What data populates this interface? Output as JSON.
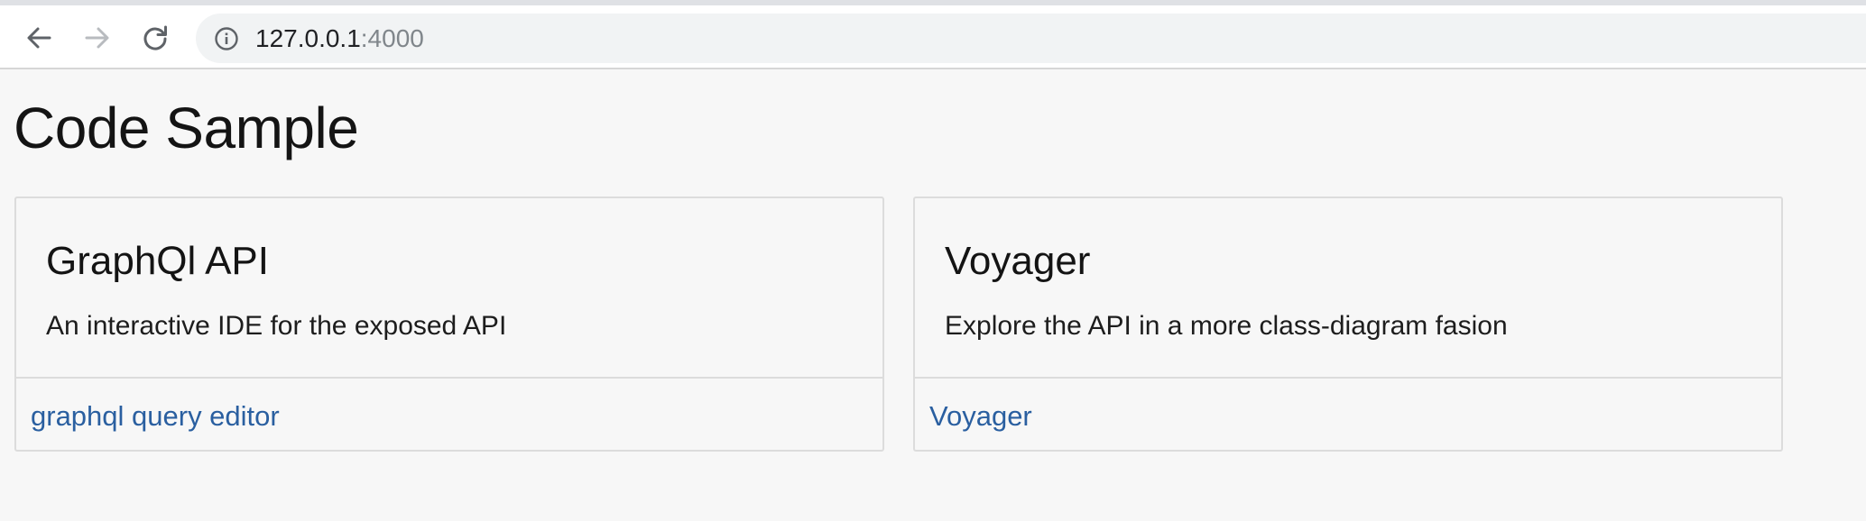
{
  "browser": {
    "url_host": "127.0.0.1",
    "url_port": ":4000",
    "icons": {
      "back": "arrow-left-icon",
      "forward": "arrow-right-icon",
      "reload": "reload-icon",
      "site_info": "info-icon"
    },
    "forward_enabled": false
  },
  "page": {
    "title": "Code Sample"
  },
  "cards": [
    {
      "title": "GraphQl API",
      "text": "An interactive IDE for the exposed API",
      "link_label": "graphql query editor"
    },
    {
      "title": "Voyager",
      "text": "Explore the API in a more class-diagram fasion",
      "link_label": "Voyager"
    }
  ],
  "colors": {
    "page_background": "#f7f7f7",
    "link": "#2a5fa0",
    "card_border": "#dcdcdc"
  }
}
